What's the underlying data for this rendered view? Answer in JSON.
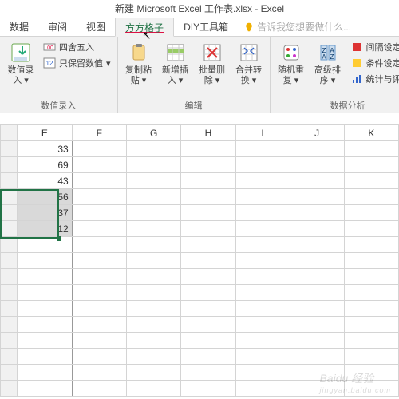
{
  "title": "新建 Microsoft Excel 工作表.xlsx - Excel",
  "tabs": {
    "data": "数据",
    "review": "审阅",
    "view": "视图",
    "fanggezi": "方方格子",
    "diy": "DIY工具箱",
    "tellme": "告诉我您想要做什么..."
  },
  "ribbon": {
    "group1": {
      "label": "数值录入",
      "bigbtn": "数值录\n入 ▾",
      "small1": "四舍五入",
      "small2": "只保留数值",
      "small2_caret": "▾"
    },
    "group2": {
      "label": "编辑",
      "btn1": "复制粘\n贴 ▾",
      "btn2": "新增插\n入 ▾",
      "btn3": "批量删\n除 ▾",
      "btn4": "合并转\n换 ▾"
    },
    "group3": {
      "label": "数据分析",
      "btn1": "随机重\n复 ▾",
      "btn2": "高级排\n序 ▾",
      "small1": "间隔设定颜色",
      "small2": "条件设定颜色",
      "small3": "统计与评级 ▾"
    }
  },
  "columns": [
    "E",
    "F",
    "G",
    "H",
    "I",
    "J",
    "K"
  ],
  "cells": {
    "E": [
      "33",
      "69",
      "43",
      "56",
      "37",
      "12"
    ]
  },
  "watermark": {
    "main": "Baidu 经验",
    "sub": "jingyan.baidu.com"
  }
}
